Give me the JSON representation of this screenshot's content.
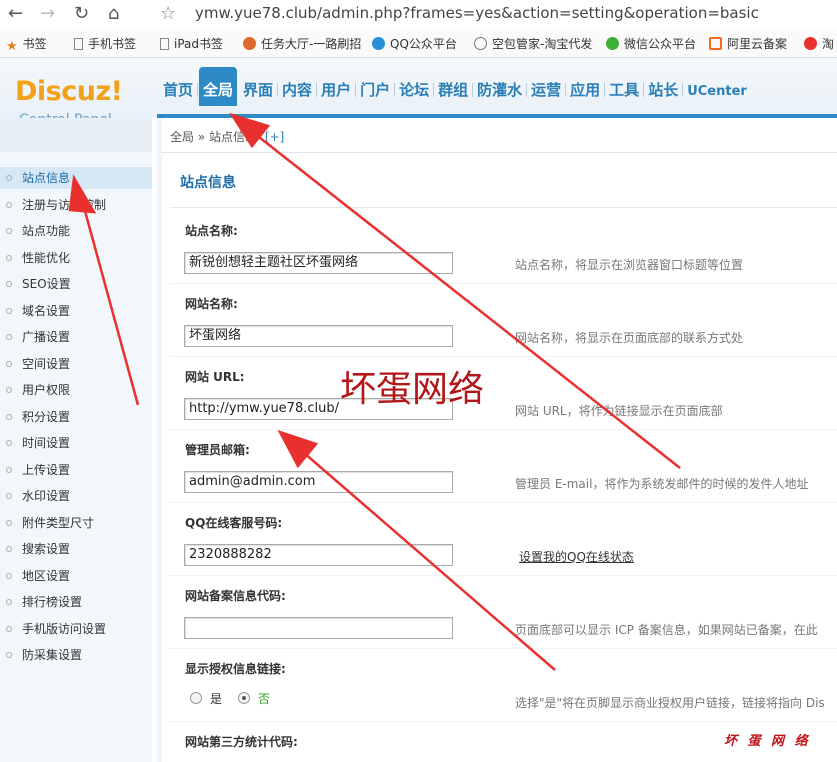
{
  "browser": {
    "url": "ymw.yue78.club/admin.php?frames=yes&action=setting&operation=basic",
    "bookmarks": [
      "书签",
      "手机书签",
      "iPad书签",
      "任务大厅-一路刷招",
      "QQ公众平台",
      "空包管家-淘宝代发",
      "微信公众平台",
      "阿里云备案",
      "淘"
    ]
  },
  "header": {
    "logo": "Discuz!",
    "logo_sub": "Control Panel",
    "nav": [
      "首页",
      "全局",
      "界面",
      "内容",
      "用户",
      "门户",
      "论坛",
      "群组",
      "防灌水",
      "运营",
      "应用",
      "工具",
      "站长",
      "UCenter"
    ],
    "active_nav": "全局"
  },
  "breadcrumb": {
    "root": "全局",
    "sep": "»",
    "current": "站点信息",
    "add": "[+]"
  },
  "sidebar": {
    "items": [
      "站点信息",
      "注册与访问控制",
      "站点功能",
      "性能优化",
      "SEO设置",
      "域名设置",
      "广播设置",
      "空间设置",
      "用户权限",
      "积分设置",
      "时间设置",
      "上传设置",
      "水印设置",
      "附件类型尺寸",
      "搜索设置",
      "地区设置",
      "排行榜设置",
      "手机版访问设置",
      "防采集设置"
    ],
    "active": "站点信息"
  },
  "main": {
    "title": "站点信息",
    "fields": {
      "site_name": {
        "label": "站点名称:",
        "value": "新锐创想轻主题社区坏蛋网络",
        "desc": "站点名称，将显示在浏览器窗口标题等位置"
      },
      "web_name": {
        "label": "网站名称:",
        "value": "坏蛋网络",
        "desc": "网站名称，将显示在页面底部的联系方式处"
      },
      "web_url": {
        "label": "网站 URL:",
        "value": "http://ymw.yue78.club/",
        "desc": "网站 URL，将作为链接显示在页面底部"
      },
      "admin_email": {
        "label": "管理员邮箱:",
        "value": "admin@admin.com",
        "desc": "管理员 E-mail，将作为系统发邮件的时候的发件人地址"
      },
      "qq_service": {
        "label": "QQ在线客服号码:",
        "value": "2320888282",
        "desc": "设置我的QQ在线状态"
      },
      "icp": {
        "label": "网站备案信息代码:",
        "value": "",
        "desc": "页面底部可以显示 ICP 备案信息，如果网站已备案，在此"
      },
      "license_link": {
        "label": "显示授权信息链接:",
        "yes": "是",
        "no": "否",
        "selected": "否",
        "desc": "选择\"是\"将在页脚显示商业授权用户链接，链接将指向 Dis"
      },
      "stat_code": {
        "label": "网站第三方统计代码:"
      }
    }
  },
  "watermark": {
    "big": "坏蛋网络",
    "small": "坏 蛋 网 络"
  },
  "colors": {
    "accent": "#2e8ac6",
    "arrow": "#e8302f",
    "watermark": "#b2161a"
  }
}
